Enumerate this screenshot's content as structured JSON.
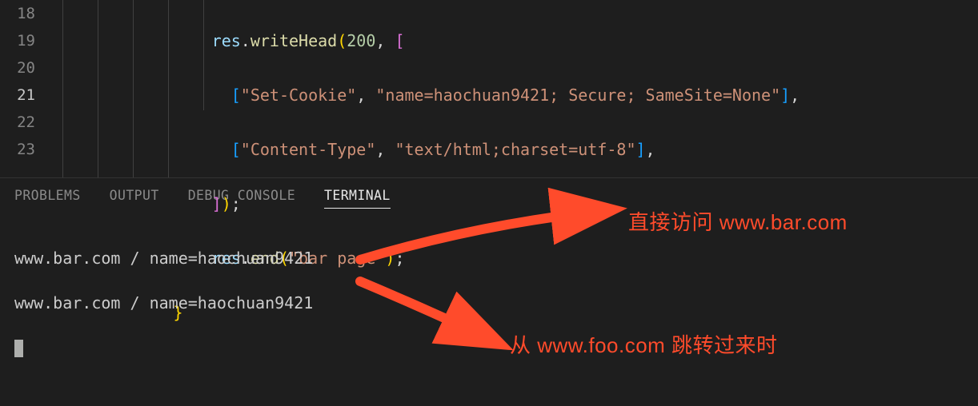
{
  "editor": {
    "line_numbers": [
      "18",
      "19",
      "20",
      "21",
      "22",
      "23"
    ],
    "current_line_index": 3,
    "code": {
      "l18": {
        "var": "res",
        "dot": ".",
        "func": "writeHead",
        "open": "(",
        "num": "200",
        "comma": ", ",
        "lbr": "["
      },
      "l19": {
        "open": "[",
        "s1": "\"Set-Cookie\"",
        "c": ", ",
        "s2": "\"name=haochuan9421; Secure; SameSite=None\"",
        "close": "]",
        "comma": ","
      },
      "l20": {
        "open": "[",
        "s1": "\"Content-Type\"",
        "c": ", ",
        "s2": "\"text/html;charset=utf-8\"",
        "close": "]",
        "comma": ","
      },
      "l21": {
        "rbr": "]",
        "rpar": ")",
        "semi": ";"
      },
      "l22": {
        "var": "res",
        "dot": ".",
        "func": "end",
        "open": "(",
        "s": "\"bar page\"",
        "close": ")",
        "semi": ";"
      },
      "l23": {
        "brace": "}"
      }
    }
  },
  "panel": {
    "tabs": {
      "problems": "PROBLEMS",
      "output": "OUTPUT",
      "debug_console": "DEBUG CONSOLE",
      "terminal": "TERMINAL"
    },
    "active_tab": "terminal",
    "terminal_lines": [
      "www.bar.com / name=haochuan9421",
      "www.bar.com / name=haochuan9421"
    ]
  },
  "annotations": {
    "top": "直接访问 www.bar.com",
    "bottom": "从 www.foo.com 跳转过来时"
  }
}
